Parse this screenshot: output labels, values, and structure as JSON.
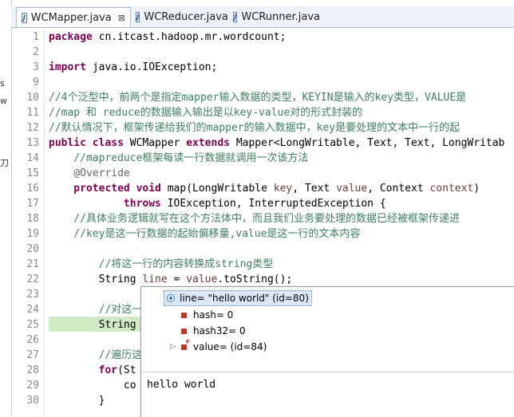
{
  "tabs": [
    {
      "label": "WCMapper.java",
      "active": true,
      "close": "⊠"
    },
    {
      "label": "WCReducer.java",
      "active": false
    },
    {
      "label": "WCRunner.java",
      "active": false
    }
  ],
  "left_strip_fragments": [
    "s",
    "w",
    "刀"
  ],
  "lines": [
    {
      "n": "1",
      "segments": [
        {
          "k": "kw",
          "t": "package"
        },
        {
          "k": "",
          "t": " cn.itcast.hadoop.mr.wordcount;"
        }
      ]
    },
    {
      "n": "2",
      "segments": []
    },
    {
      "n": "3",
      "segments": [
        {
          "k": "kw",
          "t": "import"
        },
        {
          "k": "",
          "t": " java.io.IOException;"
        }
      ]
    },
    {
      "n": "9",
      "segments": []
    },
    {
      "n": "10",
      "segments": [
        {
          "k": "cm",
          "t": "//4个泛型中，前两个是指定mapper输入数据的类型，KEYIN是输入的key类型，VALUE是"
        }
      ]
    },
    {
      "n": "11",
      "segments": [
        {
          "k": "cm",
          "t": "//map 和 reduce的数据输入输出是以key-value对的形式封装的"
        }
      ]
    },
    {
      "n": "12",
      "segments": [
        {
          "k": "cm",
          "t": "//默认情况下，框架传递给我们的mapper的输入数据中，key是要处理的文本中一行的起"
        }
      ]
    },
    {
      "n": "13",
      "segments": [
        {
          "k": "kw",
          "t": "public class"
        },
        {
          "k": "",
          "t": " WCMapper "
        },
        {
          "k": "kw",
          "t": "extends"
        },
        {
          "k": "",
          "t": " Mapper<LongWritable, Text, Text, LongWritab"
        }
      ]
    },
    {
      "n": "14",
      "segments": [
        {
          "k": "cm",
          "t": "    //mapreduce框架每读一行数据就调用一次该方法"
        }
      ]
    },
    {
      "n": "15",
      "segments": [
        {
          "k": "an",
          "t": "    @Override"
        }
      ]
    },
    {
      "n": "16",
      "segments": [
        {
          "k": "kw",
          "t": "    protected void"
        },
        {
          "k": "",
          "t": " map(LongWritable "
        },
        {
          "k": "var",
          "t": "key"
        },
        {
          "k": "",
          "t": ", Text "
        },
        {
          "k": "var",
          "t": "value"
        },
        {
          "k": "",
          "t": ", Context "
        },
        {
          "k": "var",
          "t": "context"
        },
        {
          "k": "",
          "t": ")"
        }
      ]
    },
    {
      "n": "17",
      "segments": [
        {
          "k": "kw",
          "t": "            throws"
        },
        {
          "k": "",
          "t": " IOException, InterruptedException {"
        }
      ]
    },
    {
      "n": "18",
      "segments": [
        {
          "k": "cm",
          "t": "    //具体业务逻辑就写在这个方法体中，而且我们业务要处理的数据已经被框架传递进"
        }
      ]
    },
    {
      "n": "19",
      "segments": [
        {
          "k": "cm",
          "t": "    //key是这一行数据的起始偏移量,value是这一行的文本内容"
        }
      ]
    },
    {
      "n": "20",
      "segments": []
    },
    {
      "n": "21",
      "segments": [
        {
          "k": "cm",
          "t": "        //将这一行的内容转换成string类型"
        }
      ]
    },
    {
      "n": "22",
      "segments": [
        {
          "k": "",
          "t": "        String "
        },
        {
          "k": "var",
          "t": "line"
        },
        {
          "k": "",
          "t": " = "
        },
        {
          "k": "var",
          "t": "value"
        },
        {
          "k": "",
          "t": ".toString();"
        }
      ]
    },
    {
      "n": "23",
      "segments": []
    },
    {
      "n": "24",
      "segments": [
        {
          "k": "cm",
          "t": "        //对这一"
        }
      ]
    },
    {
      "n": "25",
      "segments": [
        {
          "k": "",
          "t": "        String"
        }
      ]
    },
    {
      "n": "26",
      "segments": []
    },
    {
      "n": "27",
      "segments": [
        {
          "k": "cm",
          "t": "        //遍历这"
        }
      ]
    },
    {
      "n": "28",
      "segments": [
        {
          "k": "kw",
          "t": "        for"
        },
        {
          "k": "",
          "t": "(St"
        }
      ]
    },
    {
      "n": "29",
      "segments": [
        {
          "k": "",
          "t": "            co"
        }
      ]
    },
    {
      "n": "30",
      "segments": [
        {
          "k": "",
          "t": "        }"
        }
      ]
    }
  ],
  "popup": {
    "root": "line= \"hello world\" (id=80)",
    "children": [
      {
        "label": "hash= 0",
        "icon": "field-icon"
      },
      {
        "label": "hash32= 0",
        "icon": "field-icon"
      },
      {
        "label": "value= (id=84)",
        "icon": "final-field-icon",
        "expandable": true
      }
    ],
    "detail_value": "hello world"
  }
}
